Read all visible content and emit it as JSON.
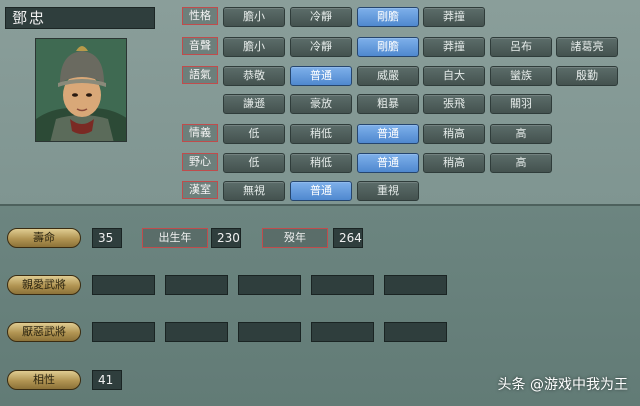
{
  "officer": {
    "name": "鄧忠"
  },
  "rows": [
    {
      "label": "性格",
      "options": [
        "膽小",
        "冷靜",
        "剛膽",
        "莽撞"
      ],
      "selected": 2
    },
    {
      "label": "音聲",
      "options": [
        "膽小",
        "冷靜",
        "剛膽",
        "莽撞",
        "呂布",
        "諸葛亮"
      ],
      "selected": 2
    },
    {
      "label": "語氣",
      "options": [
        "恭敬",
        "普通",
        "威嚴",
        "自大",
        "蠻族",
        "殷勤"
      ],
      "selected": 1
    },
    {
      "label": "",
      "options": [
        "謙遜",
        "豪放",
        "粗暴",
        "張飛",
        "關羽"
      ],
      "selected": -1
    },
    {
      "label": "情義",
      "options": [
        "低",
        "稍低",
        "普通",
        "稍高",
        "高"
      ],
      "selected": 2
    },
    {
      "label": "野心",
      "options": [
        "低",
        "稍低",
        "普通",
        "稍高",
        "高"
      ],
      "selected": 2
    },
    {
      "label": "漢室",
      "options": [
        "無視",
        "普通",
        "重視"
      ],
      "selected": 1
    }
  ],
  "lifespan": {
    "label": "壽命",
    "value": "35"
  },
  "birth_year": {
    "label": "出生年",
    "value": "230"
  },
  "death_year": {
    "label": "歿年",
    "value": "264"
  },
  "liked_generals": {
    "label": "親愛武將"
  },
  "disliked_generals": {
    "label": "厭惡武將"
  },
  "compatibility": {
    "label": "相性",
    "value": "41"
  },
  "watermark": "头条 @游戏中我为王",
  "colors": {
    "selected": "#5b93d6",
    "label_border": "#c04c4c",
    "gold": "#c9b06f"
  }
}
